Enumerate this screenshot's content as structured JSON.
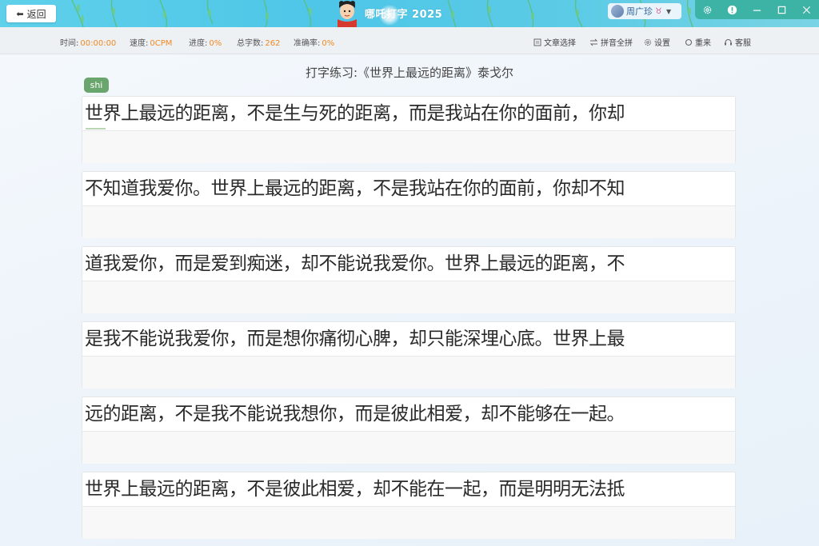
{
  "titlebar": {
    "back_label": "返回",
    "app_title": "哪吒打字 2025",
    "user_name": "周广珍",
    "user_badge": "♉"
  },
  "icons": {
    "back": "back-arrow-icon",
    "settings": "gear-icon",
    "info": "info-icon",
    "minimize": "minimize-icon",
    "maximize": "maximize-icon",
    "close": "close-icon"
  },
  "stats": {
    "time_label": "时间:",
    "time_value": "00:00:00",
    "speed_label": "速度:",
    "speed_value": "0CPM",
    "progress_label": "进度:",
    "progress_value": "0%",
    "total_label": "总字数:",
    "total_value": "262",
    "accuracy_label": "准确率:",
    "accuracy_value": "0%"
  },
  "tools": {
    "article_select": "文章选择",
    "pinyin_full": "拼音全拼",
    "settings": "设置",
    "restart": "重来",
    "service": "客服"
  },
  "practice": {
    "title": "打字练习:《世界上最远的距离》泰戈尔",
    "current_pinyin": "shi",
    "lines": [
      "世界上最远的距离，不是生与死的距离，而是我站在你的面前，你却",
      "不知道我爱你。世界上最远的距离，不是我站在你的面前，你却不知",
      "道我爱你，而是爱到痴迷，却不能说我爱你。世界上最远的距离，不",
      "是我不能说我爱你，而是想你痛彻心脾，却只能深埋心底。世界上最",
      "远的距离，不是我不能说我想你，而是彼此相爱，却不能够在一起。",
      "世界上最远的距离，不是彼此相爱，却不能在一起，而是明明无法抵"
    ]
  },
  "colors": {
    "accent_orange": "#f08a24",
    "pinyin_tag": "#6aa56d",
    "titlebar": "#4ec6e8",
    "window_controls": "#3db3a6"
  }
}
